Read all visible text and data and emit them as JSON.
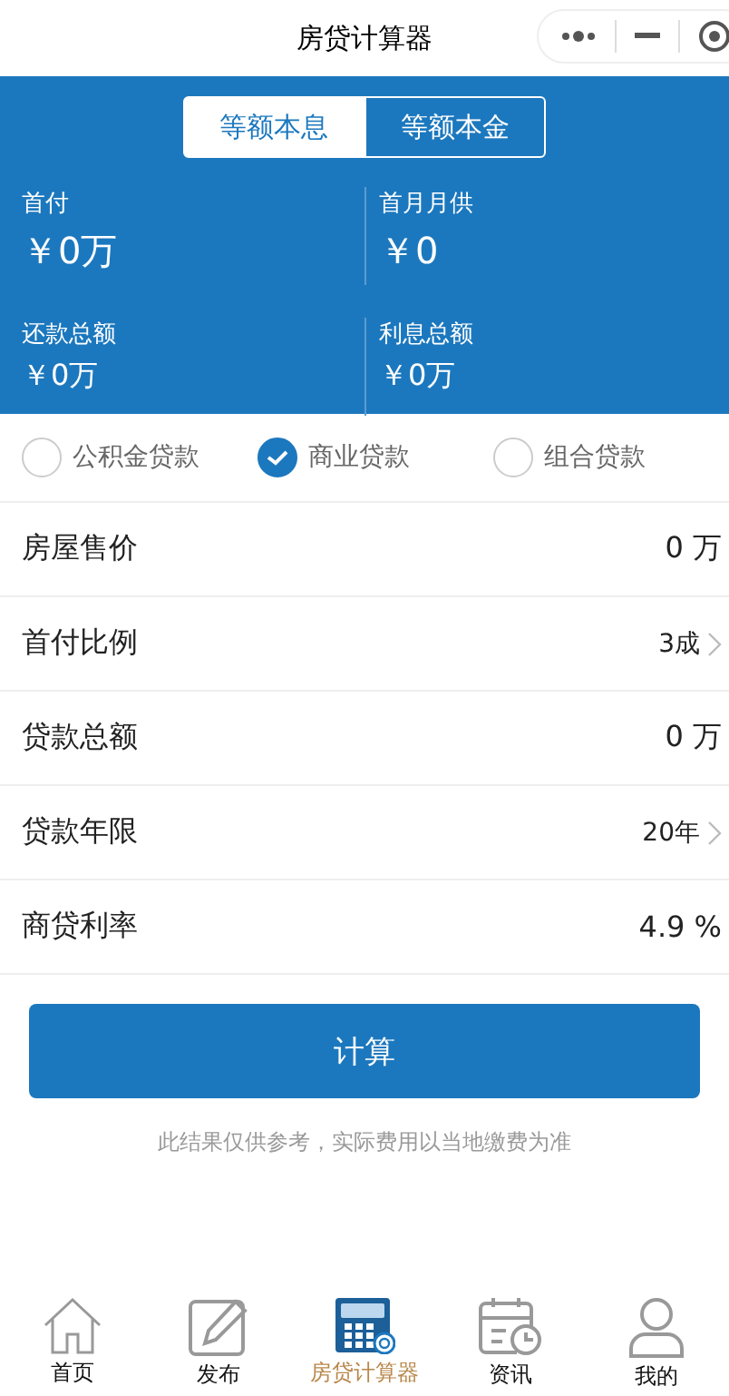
{
  "window": {
    "title": "房贷计算器"
  },
  "tabs": [
    {
      "label": "等额本息",
      "selected": true
    },
    {
      "label": "等额本金",
      "selected": false
    }
  ],
  "summary": [
    {
      "label": "首付",
      "value": "￥0万"
    },
    {
      "label": "首月月供",
      "value": "￥0"
    },
    {
      "label": "还款总额",
      "value": "￥0万"
    },
    {
      "label": "利息总额",
      "value": "￥0万"
    }
  ],
  "loan_types": [
    {
      "label": "公积金贷款",
      "selected": false
    },
    {
      "label": "商业贷款",
      "selected": true
    },
    {
      "label": "组合贷款",
      "selected": false
    }
  ],
  "fields": [
    {
      "label": "房屋售价",
      "value": "0 万",
      "kind": "input"
    },
    {
      "label": "首付比例",
      "value": "3成",
      "kind": "picker"
    },
    {
      "label": "贷款总额",
      "value": "0 万",
      "kind": "input"
    },
    {
      "label": "贷款年限",
      "value": "20年",
      "kind": "picker"
    },
    {
      "label": "商贷利率",
      "value": "4.9 %",
      "kind": "input"
    }
  ],
  "calculate_button": "计算",
  "note": "此结果仅供参考，实际费用以当地缴费为准",
  "tab_bar": [
    {
      "label": "首页",
      "kind": "home",
      "selected": false
    },
    {
      "label": "发布",
      "kind": "edit",
      "selected": false
    },
    {
      "label": "房贷计算器",
      "kind": "calc",
      "selected": true
    },
    {
      "label": "资讯",
      "kind": "calendar",
      "selected": false
    },
    {
      "label": "我的",
      "kind": "user",
      "selected": false
    }
  ]
}
